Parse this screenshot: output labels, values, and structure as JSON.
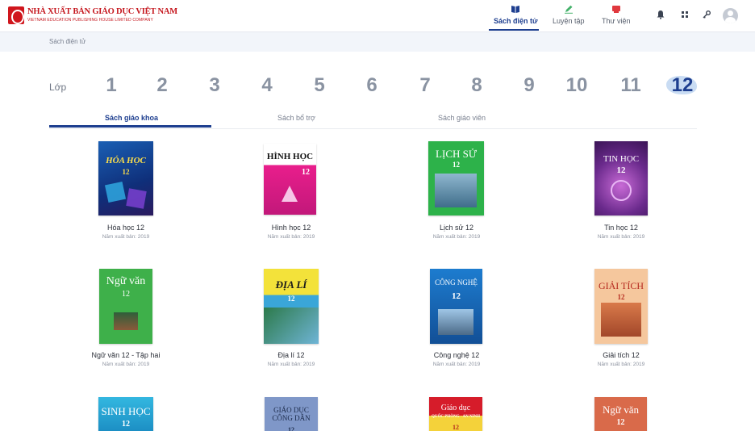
{
  "header": {
    "logo_title": "NHÀ XUẤT BẢN GIÁO DỤC VIỆT NAM",
    "logo_subtitle": "VIETNAM EDUCATION PUBLISHING HOUSE LIMITED COMPANY",
    "nav": [
      {
        "label": "Sách điện tử",
        "icon": "book-icon",
        "active": true
      },
      {
        "label": "Luyện tập",
        "icon": "pencil-icon",
        "active": false
      },
      {
        "label": "Thư viện",
        "icon": "library-icon",
        "active": false
      }
    ],
    "icons": [
      "bell-icon",
      "apps-grid-icon",
      "key-icon",
      "user-avatar-icon"
    ],
    "accent_color": "#1d3e8f",
    "brand_color": "#c5161d"
  },
  "breadcrumb": "Sách điện tử",
  "grades": {
    "label": "Lớp",
    "items": [
      "1",
      "2",
      "3",
      "4",
      "5",
      "6",
      "7",
      "8",
      "9",
      "10",
      "11",
      "12"
    ],
    "selected": "12"
  },
  "tabs": [
    {
      "label": "Sách giáo khoa",
      "active": true
    },
    {
      "label": "Sách bổ trợ",
      "active": false
    },
    {
      "label": "Sách giáo viên",
      "active": false
    }
  ],
  "books": [
    {
      "title": "Hóa học 12",
      "year": "Năm xuất bản: 2019",
      "cover_text": "HÓA HỌC",
      "cover_num": "12"
    },
    {
      "title": "Hình học 12",
      "year": "Năm xuất bản: 2019",
      "cover_text": "HÌNH HỌC",
      "cover_num": "12"
    },
    {
      "title": "Lịch sử 12",
      "year": "Năm xuất bản: 2019",
      "cover_text": "LỊCH SỬ",
      "cover_num": "12"
    },
    {
      "title": "Tin học 12",
      "year": "Năm xuất bản: 2019",
      "cover_text": "TIN HỌC",
      "cover_num": "12"
    },
    {
      "title": "Ngữ văn 12 - Tập hai",
      "year": "Năm xuất bản: 2019",
      "cover_text": "Ngữ văn",
      "cover_num": "12"
    },
    {
      "title": "Địa lí 12",
      "year": "Năm xuất bản: 2019",
      "cover_text": "ĐỊA LÍ",
      "cover_num": "12"
    },
    {
      "title": "Công nghệ 12",
      "year": "Năm xuất bản: 2019",
      "cover_text": "CÔNG NGHỆ",
      "cover_num": "12"
    },
    {
      "title": "Giải tích 12",
      "year": "Năm xuất bản: 2019",
      "cover_text": "GIẢI TÍCH",
      "cover_num": "12"
    },
    {
      "cover_text": "SINH HỌC",
      "cover_num": "12"
    },
    {
      "cover_text": "GIÁO DỤC CÔNG DÂN",
      "cover_num": "12"
    },
    {
      "cover_text": "Giáo dục",
      "cover_subtext": "QUỐC PHÒNG - AN NINH",
      "cover_num": "12"
    },
    {
      "cover_text": "Ngữ văn",
      "cover_num": "12"
    }
  ]
}
